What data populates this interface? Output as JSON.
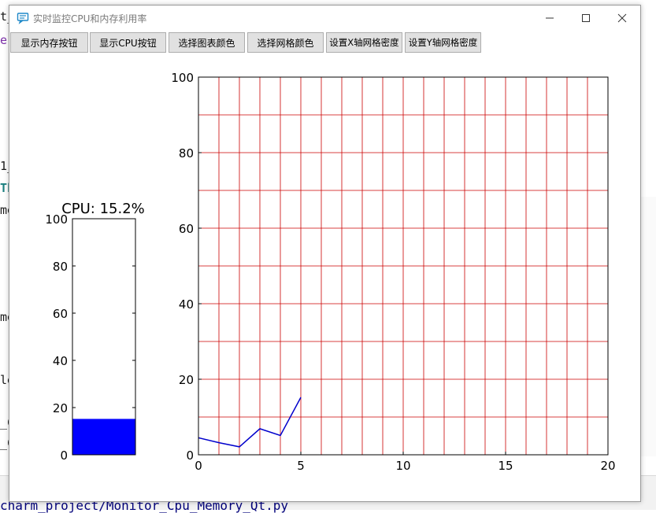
{
  "background": {
    "editor_fragments": [
      "t_",
      "e:",
      "1_",
      "Th",
      "me",
      "me",
      "le",
      "_C",
      "_C"
    ],
    "file_path": "charm_project/Monitor_Cpu_Memory_Qt.py"
  },
  "window": {
    "title": "实时监控CPU和内存利用率",
    "controls": {
      "minimize_icon": "minimize-icon",
      "maximize_icon": "maximize-icon",
      "close_icon": "close-icon"
    }
  },
  "toolbar": {
    "buttons": [
      {
        "label": "显示内存按钮"
      },
      {
        "label": "显示CPU按钮"
      },
      {
        "label": "选择图表颜色"
      },
      {
        "label": "选择网格颜色"
      },
      {
        "label": "设置X轴网格密度"
      },
      {
        "label": "设置Y轴网格密度"
      }
    ]
  },
  "colors": {
    "bar_fill": "#0000ff",
    "line": "#0000cc",
    "grid": "#cc0000",
    "axis": "#000000"
  },
  "chart_data": [
    {
      "type": "bar",
      "title": "CPU: 15.2%",
      "categories": [
        ""
      ],
      "values": [
        15.2
      ],
      "ylim": [
        0,
        100
      ],
      "yticks": [
        0,
        20,
        40,
        60,
        80,
        100
      ],
      "xlabel": "",
      "ylabel": "",
      "grid": false
    },
    {
      "type": "line",
      "title": "",
      "x": [
        0,
        1,
        2,
        3,
        4,
        5
      ],
      "y": [
        4.5,
        3.2,
        2.1,
        6.9,
        5.1,
        15.2
      ],
      "xlim": [
        0,
        20
      ],
      "ylim": [
        0,
        100
      ],
      "xticks": [
        0,
        5,
        10,
        15,
        20
      ],
      "yticks": [
        0,
        20,
        40,
        60,
        80,
        100
      ],
      "x_grid_step": 1,
      "y_grid_step": 10,
      "xlabel": "",
      "ylabel": "",
      "grid": true
    }
  ]
}
